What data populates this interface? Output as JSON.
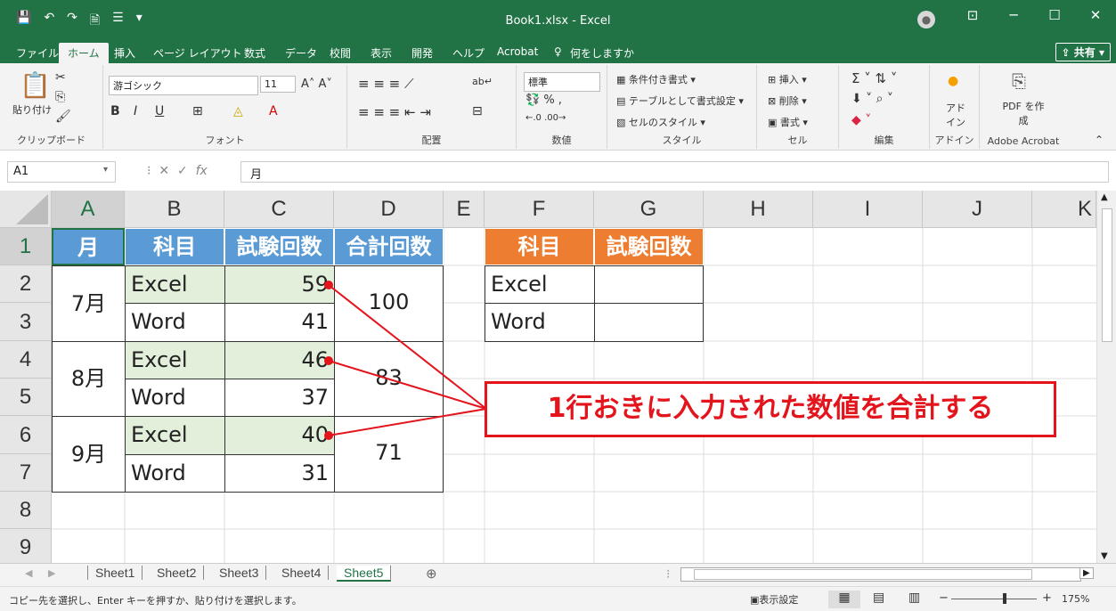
{
  "titlebar": {
    "title": "Book1.xlsx  -  Excel",
    "qat": [
      "💾",
      "↶",
      "↷",
      "🗎",
      "☰",
      "▾"
    ],
    "controls": [
      "⊡",
      "─",
      "☐",
      "✕"
    ]
  },
  "tabs": [
    {
      "label": "ファイル"
    },
    {
      "label": "ホーム"
    },
    {
      "label": "挿入"
    },
    {
      "label": "ページ レイアウト"
    },
    {
      "label": "数式"
    },
    {
      "label": "データ"
    },
    {
      "label": "校閲"
    },
    {
      "label": "表示"
    },
    {
      "label": "開発"
    },
    {
      "label": "ヘルプ"
    },
    {
      "label": "Acrobat"
    },
    {
      "label": "何をしますか"
    }
  ],
  "share_label": "共有",
  "ribbon": {
    "clipboard": {
      "label": "クリップボード",
      "paste": "貼り付け"
    },
    "font": {
      "label": "フォント",
      "name": "游ゴシック",
      "size": "11"
    },
    "alignment": {
      "label": "配置"
    },
    "number": {
      "label": "数値",
      "format": "標準"
    },
    "styles": {
      "label": "スタイル",
      "items": [
        "条件付き書式",
        "テーブルとして書式設定",
        "セルのスタイル"
      ]
    },
    "cells": {
      "label": "セル",
      "items": [
        "挿入",
        "削除",
        "書式"
      ]
    },
    "editing": {
      "label": "編集"
    },
    "addins": {
      "label": "アドイン",
      "btn": "アド イン"
    },
    "acrobat": {
      "label": "Adobe Acrobat",
      "btn": "PDF を作成"
    }
  },
  "formula_bar": {
    "name_box": "A1",
    "formula": "月",
    "fx": "fx"
  },
  "columns": [
    "A",
    "B",
    "C",
    "D",
    "E",
    "F",
    "G",
    "H",
    "I",
    "J",
    "K"
  ],
  "rows": [
    "1",
    "2",
    "3",
    "4",
    "5",
    "6",
    "7",
    "8",
    "9"
  ],
  "table1": {
    "headers": [
      "月",
      "科目",
      "試験回数",
      "合計回数"
    ],
    "months": [
      "7月",
      "8月",
      "9月"
    ],
    "subjects": [
      "Excel",
      "Word",
      "Excel",
      "Word",
      "Excel",
      "Word"
    ],
    "counts": [
      "59",
      "41",
      "46",
      "37",
      "40",
      "31"
    ],
    "totals": [
      "100",
      "83",
      "71"
    ]
  },
  "table2": {
    "headers": [
      "科目",
      "試験回数"
    ],
    "subjects": [
      "Excel",
      "Word"
    ]
  },
  "callout": "1行おきに入力された数値を合計する",
  "sheets": [
    "Sheet1",
    "Sheet2",
    "Sheet3",
    "Sheet4",
    "Sheet5"
  ],
  "status": {
    "message": "コピー先を選択し、Enter キーを押すか、貼り付けを選択します。",
    "display_settings": "表示設定",
    "zoom": "175%"
  },
  "colors": {
    "excel_green": "#217346",
    "header_blue": "#5b9bd5",
    "header_orange": "#ed7d31",
    "accent_red": "#e3141c",
    "fill_green": "#e2efda"
  }
}
